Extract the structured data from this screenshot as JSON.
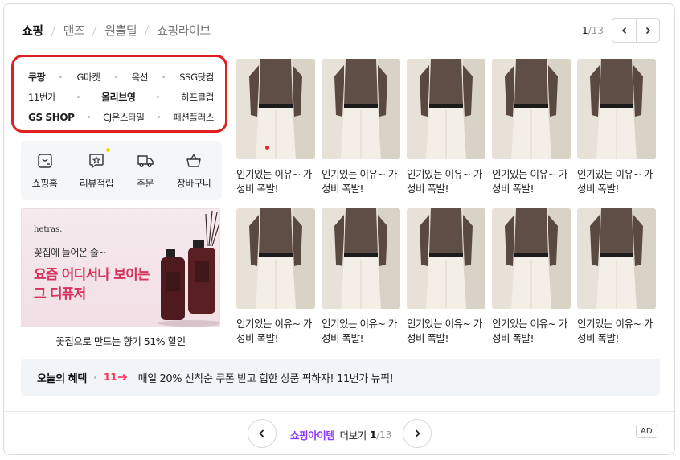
{
  "tabs": [
    "쇼핑",
    "맨즈",
    "원쁠딜",
    "쇼핑라이브"
  ],
  "pager": {
    "current": "1",
    "total": "/13"
  },
  "malls": [
    [
      "쿠팡",
      "G마켓",
      "옥션",
      "SSG닷컴"
    ],
    [
      "11번가",
      "올리브영",
      "하프클럽"
    ],
    [
      "GS SHOP",
      "CJ온스타일",
      "패션플러스"
    ]
  ],
  "shortcuts": [
    "쇼핑홈",
    "리뷰적립",
    "주문",
    "장바구니"
  ],
  "ad_banner": {
    "brand": "hetras.",
    "sub": "꽃집에 들어온 줄~",
    "title": "요즘 어디서나 보이는 그 디퓨저",
    "caption": "꽃집으로 만드는 향기 51% 할인"
  },
  "products": [
    "인기있는 이유~ 가성비 폭발!",
    "인기있는 이유~ 가성비 폭발!",
    "인기있는 이유~ 가성비 폭발!",
    "인기있는 이유~ 가성비 폭발!",
    "인기있는 이유~ 가성비 폭발!",
    "인기있는 이유~ 가성비 폭발!",
    "인기있는 이유~ 가성비 폭발!",
    "인기있는 이유~ 가성비 폭발!",
    "인기있는 이유~ 가성비 폭발!",
    "인기있는 이유~ 가성비 폭발!"
  ],
  "benefit": {
    "label": "오늘의 혜택",
    "logo": "11",
    "text": "매일 20% 선착순 쿠폰 받고 힙한 상품 픽하자! 11번가 뉴픽!"
  },
  "footer": {
    "category": "쇼핑아이템",
    "more": "더보기",
    "current": "1",
    "total": "/13",
    "ad": "AD"
  },
  "colors": {
    "accent": "#8a35ff",
    "highlight_border": "#e02020",
    "title_pink": "#d6335c",
    "eleven_red": "#ff2c55"
  }
}
